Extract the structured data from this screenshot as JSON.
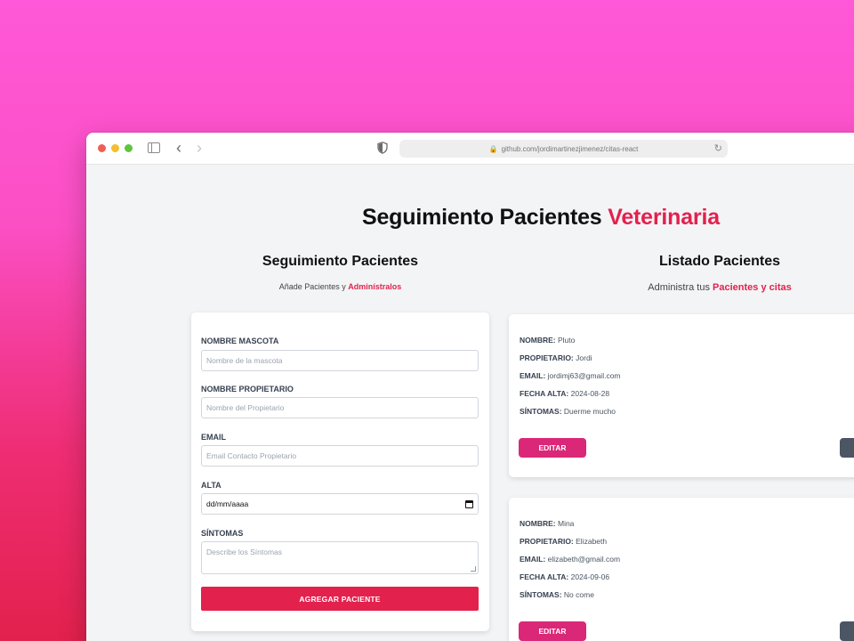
{
  "browser": {
    "url": "github.com/jordimartinezjimenez/citas-react"
  },
  "app": {
    "title_main": "Seguimiento Pacientes",
    "title_accent": "Veterinaria"
  },
  "form_section": {
    "heading": "Seguimiento Pacientes",
    "sub_prefix": "Añade Pacientes y",
    "sub_accent": "Adminístralos",
    "fields": {
      "mascota": {
        "label": "NOMBRE MASCOTA",
        "placeholder": "Nombre de la mascota"
      },
      "propietario": {
        "label": "NOMBRE PROPIETARIO",
        "placeholder": "Nombre del Propietario"
      },
      "email": {
        "label": "EMAIL",
        "placeholder": "Email Contacto Propietario"
      },
      "alta": {
        "label": "ALTA",
        "value": "dd/mm/aaaa"
      },
      "sintomas": {
        "label": "SÍNTOMAS",
        "placeholder": "Describe los Síntomas"
      }
    },
    "submit_label": "AGREGAR PACIENTE"
  },
  "list_section": {
    "heading": "Listado Pacientes",
    "sub_prefix": "Administra tus",
    "sub_accent": "Pacientes y citas",
    "keys": {
      "nombre": "NOMBRE:",
      "propietario": "PROPIETARIO:",
      "email": "EMAIL:",
      "fecha": "FECHA ALTA:",
      "sintomas": "SÍNTOMAS:"
    },
    "edit_label": "EDITAR",
    "patients": [
      {
        "nombre": "Pluto",
        "propietario": "Jordi",
        "email": "jordimj63@gmail.com",
        "fecha": "2024-08-28",
        "sintomas": "Duerme mucho"
      },
      {
        "nombre": "Mina",
        "propietario": "Elizabeth",
        "email": "elizabeth@gmail.com",
        "fecha": "2024-09-06",
        "sintomas": "No come"
      }
    ]
  },
  "colors": {
    "accent": "#e3214d",
    "edit_button": "#db2777",
    "delete_button": "#4b5563",
    "page_background": "#f3f4f6"
  }
}
